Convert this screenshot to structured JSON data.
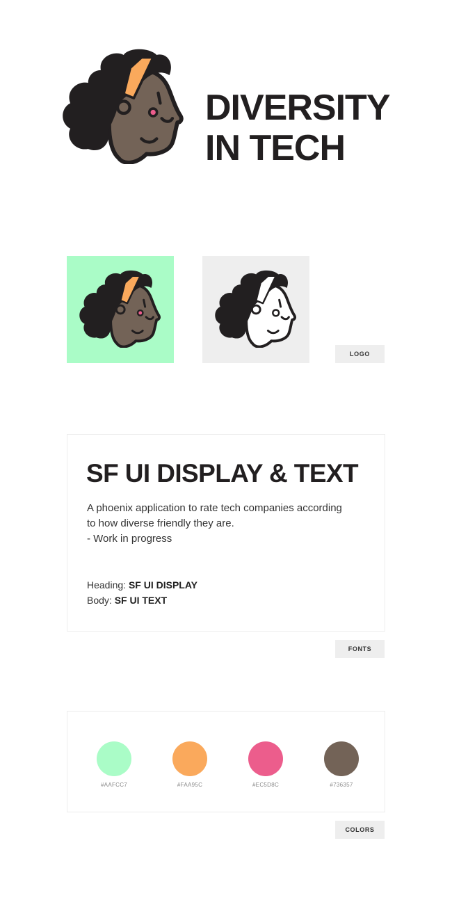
{
  "brand": {
    "title_line1": "DIVERSITY",
    "title_line2": "IN TECH"
  },
  "logo_section": {
    "tile_color_bg": "#AAFCC7",
    "tile_mono_bg": "#EEEEEE",
    "tag": "LOGO"
  },
  "fonts_section": {
    "heading": "SF UI DISPLAY & TEXT",
    "body_line1": "A phoenix application to rate tech companies according",
    "body_line2": "to how diverse friendly they are.",
    "body_line3": "- Work in progress",
    "heading_label": "Heading:",
    "heading_font": "SF UI DISPLAY",
    "body_label": "Body:",
    "body_font": "SF UI TEXT",
    "tag": "FONTS"
  },
  "colors_section": {
    "swatches": [
      {
        "hex": "#AAFCC7",
        "label": "#AAFCC7"
      },
      {
        "hex": "#FAA95C",
        "label": "#FAA95C"
      },
      {
        "hex": "#EC5D8C",
        "label": "#EC5D8C"
      },
      {
        "hex": "#736357",
        "label": "#736357"
      }
    ],
    "tag": "COLORS"
  },
  "icons": {
    "logo": "afro-hair-character-logo-icon"
  }
}
